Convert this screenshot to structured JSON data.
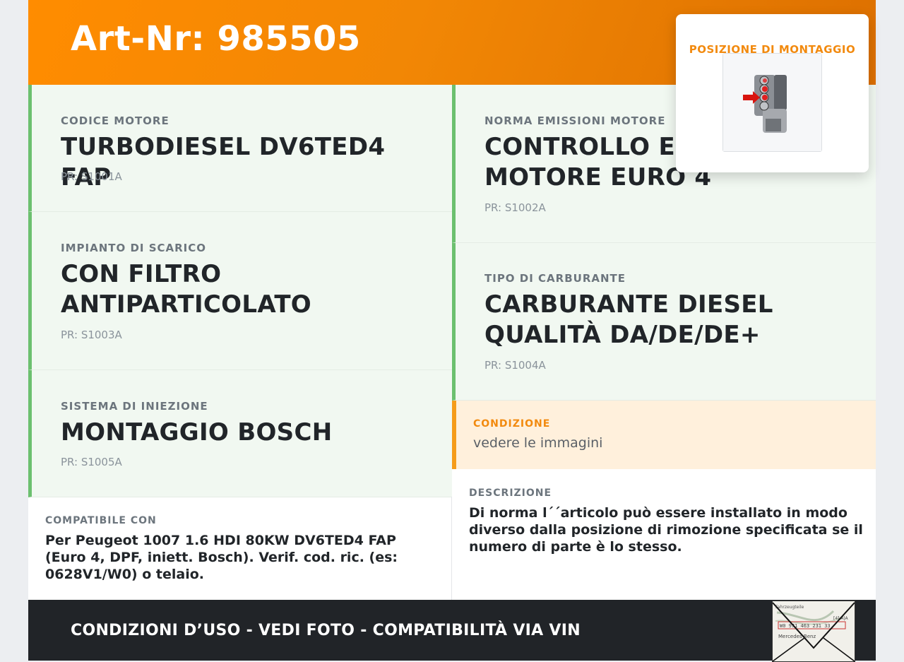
{
  "header": {
    "art_nr": "Art-Nr: 985505"
  },
  "position_card": {
    "title": "POSIZIONE DI MONTAGGIO",
    "image_icon": "engine-position-image"
  },
  "specs": {
    "engine_code": {
      "label": "CODICE MOTORE",
      "value": "TURBODIESEL DV6TED4 FAP",
      "pr": "PR: S1001A"
    },
    "emission": {
      "label": "NORMA EMISSIONI MOTORE",
      "value": "CONTROLLO EMISSIONI MOTORE EURO 4",
      "pr": "PR: S1002A"
    },
    "exhaust": {
      "label": "IMPIANTO DI SCARICO",
      "value": "CON FILTRO ANTIPARTICOLATO",
      "pr": "PR: S1003A"
    },
    "fuel": {
      "label": "TIPO DI CARBURANTE",
      "value": "CARBURANTE DIESEL QUALITÀ DA/DE/DE+",
      "pr": "PR: S1004A"
    },
    "injection": {
      "label": "SISTEMA DI INIEZIONE",
      "value": "MONTAGGIO BOSCH",
      "pr": "PR: S1005A"
    }
  },
  "condition": {
    "label": "CONDIZIONE",
    "value": "vedere le immagini"
  },
  "compatible": {
    "label": "COMPATIBILE CON",
    "text": "Per Peugeot 1007 1.6 HDI 80KW DV6TED4 FAP (Euro 4, DPF, iniett. Bosch). Verif. cod. ric. (es: 0628V1/W0) o telaio."
  },
  "description": {
    "label": "DESCRIZIONE",
    "text": "Di norma l´´articolo può essere installato in modo diverso dalla posizione di rimozione specificata se il numero di parte è lo stesso."
  },
  "footer": {
    "text": "CONDIZIONI D’USO - VEDI FOTO - COMPATIBILITÀ VIA VIN",
    "image_icon": "envelope-label-image"
  },
  "colors": {
    "header_orange": "#f28705",
    "accent_green": "#6cc06f",
    "condition_orange": "#f59c1a",
    "footer_dark": "#212428"
  }
}
